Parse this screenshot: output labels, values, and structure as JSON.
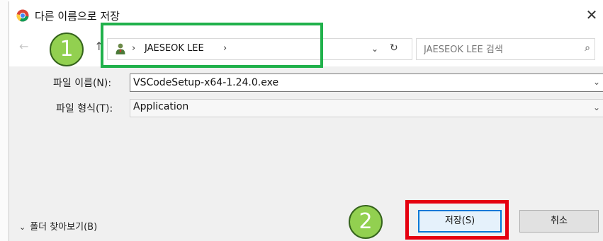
{
  "window": {
    "title": "다른 이름으로 저장",
    "close_glyph": "✕",
    "app_icon": "chrome-icon"
  },
  "navigation": {
    "back_glyph": "←",
    "up_glyph": "↑",
    "breadcrumb": {
      "icon": "user-folder-icon",
      "separator": "›",
      "location": "JAESEOK LEE"
    },
    "dropdown_glyph": "⌄",
    "refresh_glyph": "↻",
    "search": {
      "placeholder": "JAESEOK LEE 검색",
      "icon": "search-icon",
      "glyph": "⌕"
    }
  },
  "fields": {
    "filename": {
      "label": "파일 이름(N):",
      "value": "VSCodeSetup-x64-1.24.0.exe",
      "dropdown_glyph": "⌄"
    },
    "filetype": {
      "label": "파일 형식(T):",
      "value": "Application",
      "dropdown_glyph": "⌄"
    }
  },
  "footer": {
    "browse_chevron": "⌄",
    "browse_label": "폴더 찾아보기(B)",
    "save_label": "저장(S)",
    "cancel_label": "취소"
  },
  "annotations": {
    "marker_1": "1",
    "marker_2": "2",
    "green_box_color": "#20b14b",
    "red_box_color": "#e5000f",
    "marker_fill": "#92d050"
  }
}
